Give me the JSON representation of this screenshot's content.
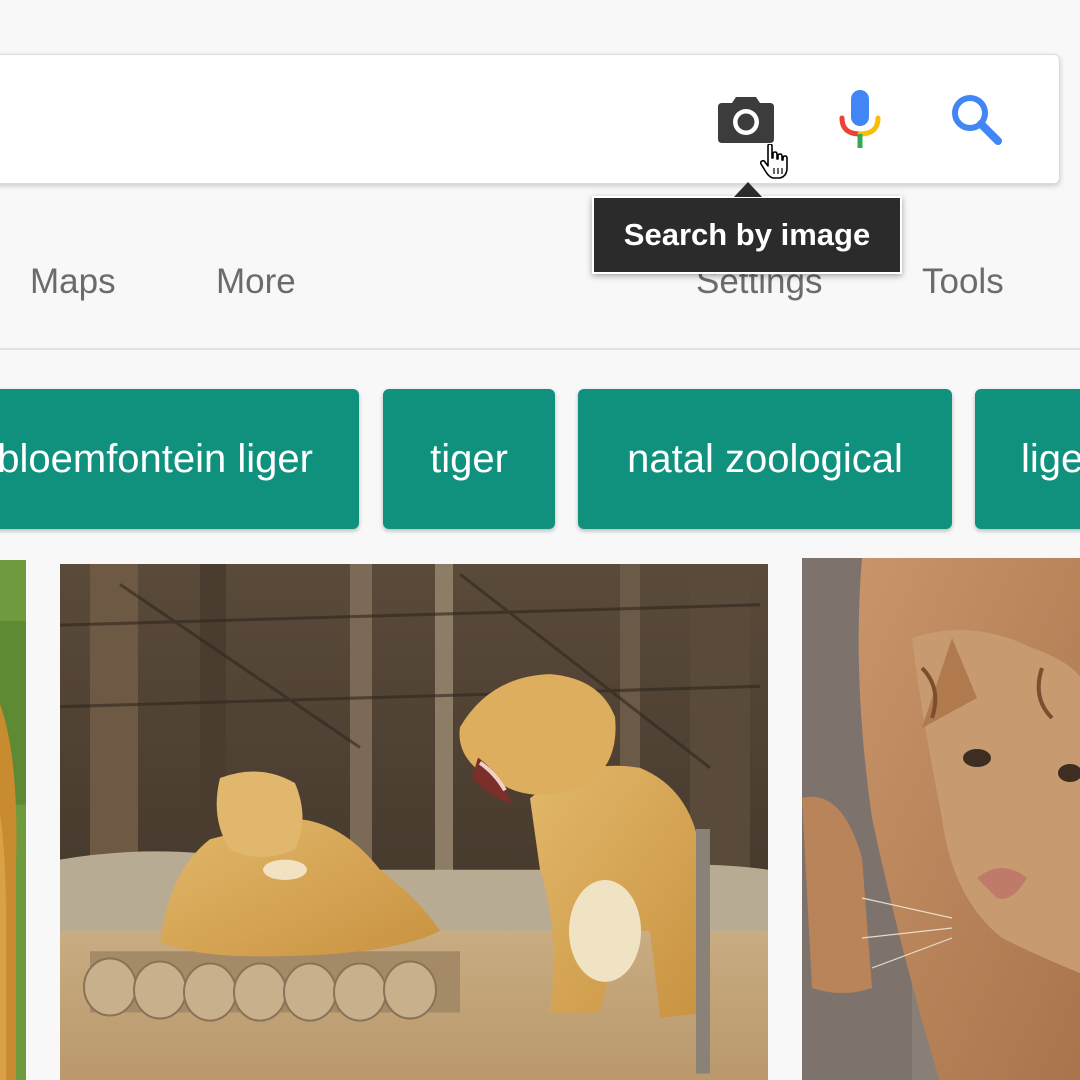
{
  "search": {
    "query": "",
    "placeholder": ""
  },
  "icons": {
    "camera": "camera-icon",
    "mic": "microphone-icon",
    "search": "magnifier-icon",
    "cursor": "hand-pointer-cursor"
  },
  "tooltip": {
    "text": "Search by image"
  },
  "nav": {
    "maps": "Maps",
    "more": "More",
    "settings": "Settings",
    "tools": "Tools"
  },
  "chips": [
    {
      "label": "bloemfontein liger"
    },
    {
      "label": "tiger"
    },
    {
      "label": "natal zoological"
    },
    {
      "label": "liger"
    }
  ],
  "results": [
    {
      "subject": "liger (partial)"
    },
    {
      "subject": "two ligers in zoo enclosure"
    },
    {
      "subject": "liger close-up"
    }
  ],
  "colors": {
    "chip_bg": "#0f917e",
    "tooltip_bg": "#2b2b2b",
    "google_blue": "#4285f4",
    "google_red": "#ea4335",
    "google_yellow": "#fbbc05",
    "google_green": "#34a853",
    "nav_text": "#6b6b6b",
    "page_bg": "#f8f8f8"
  }
}
